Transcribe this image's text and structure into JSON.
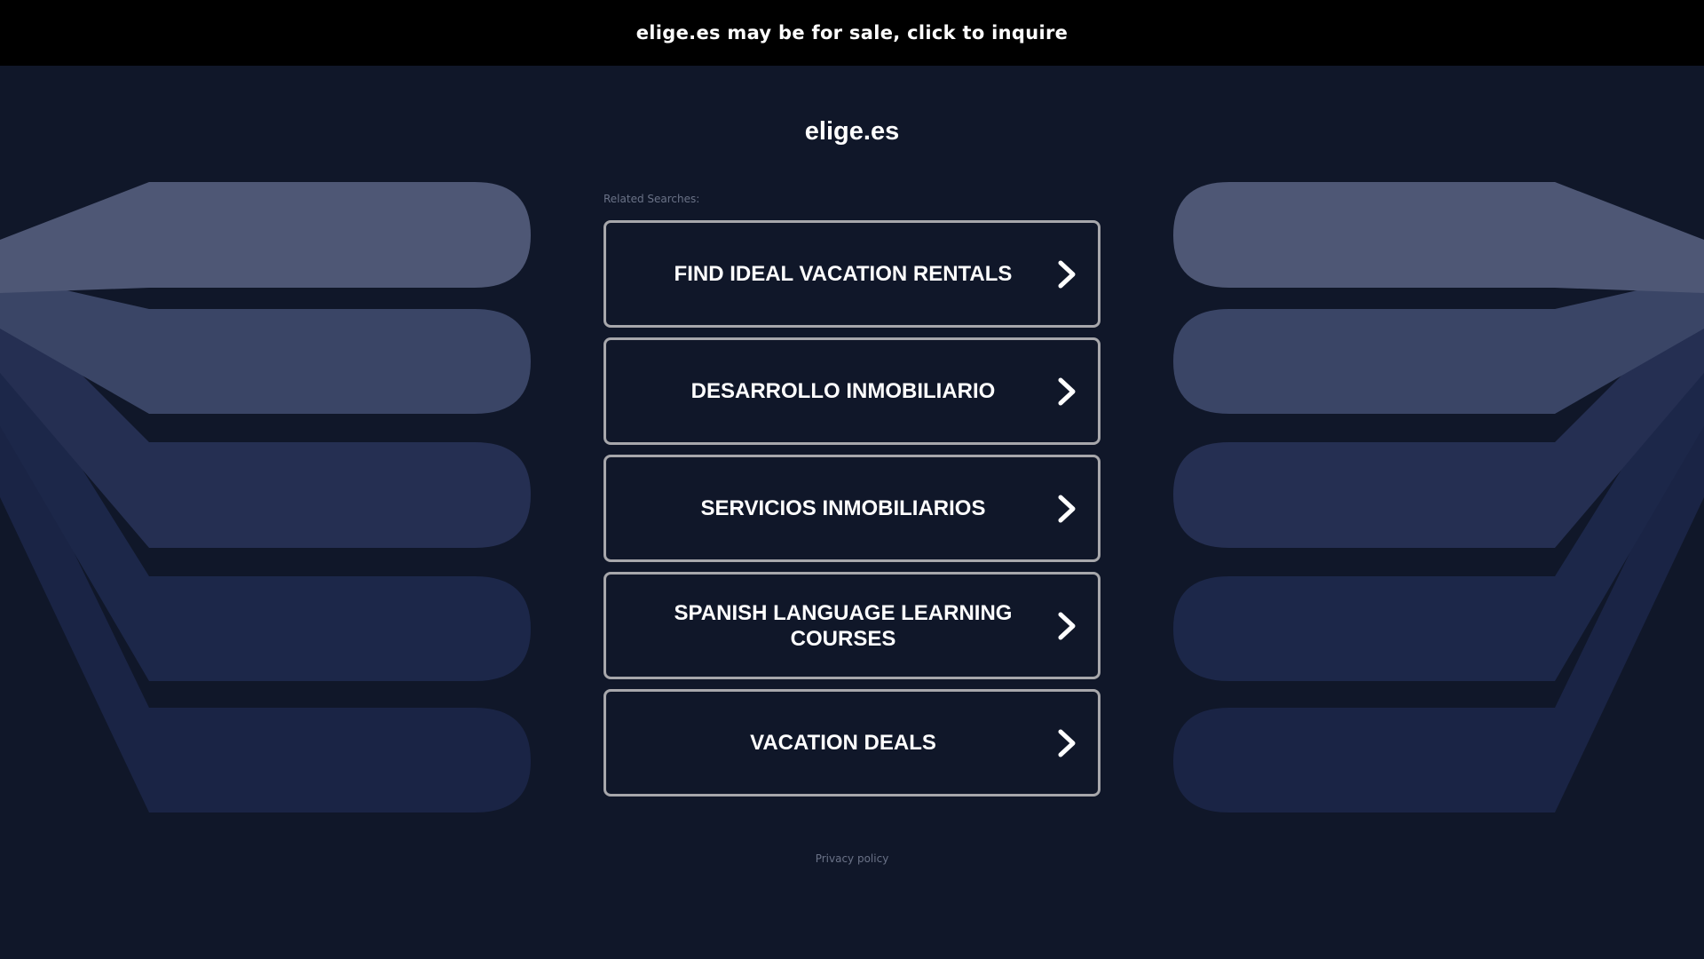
{
  "banner": {
    "text": "elige.es may be for sale, click to inquire"
  },
  "site": {
    "domain": "elige.es"
  },
  "related": {
    "label": "Related Searches:",
    "items": [
      {
        "label": "FIND IDEAL VACATION RENTALS"
      },
      {
        "label": "DESARROLLO INMOBILIARIO"
      },
      {
        "label": "SERVICIOS INMOBILIARIOS"
      },
      {
        "label": "SPANISH LANGUAGE LEARNING COURSES"
      },
      {
        "label": "VACATION DEALS"
      }
    ]
  },
  "footer": {
    "privacy_label": "Privacy policy"
  },
  "colors": {
    "background": "#101729",
    "banner": "#000000",
    "button_border": "#a7a7ab",
    "muted_text": "#6a7287"
  },
  "icons": {
    "button_arrow": "chevron-right-icon"
  }
}
